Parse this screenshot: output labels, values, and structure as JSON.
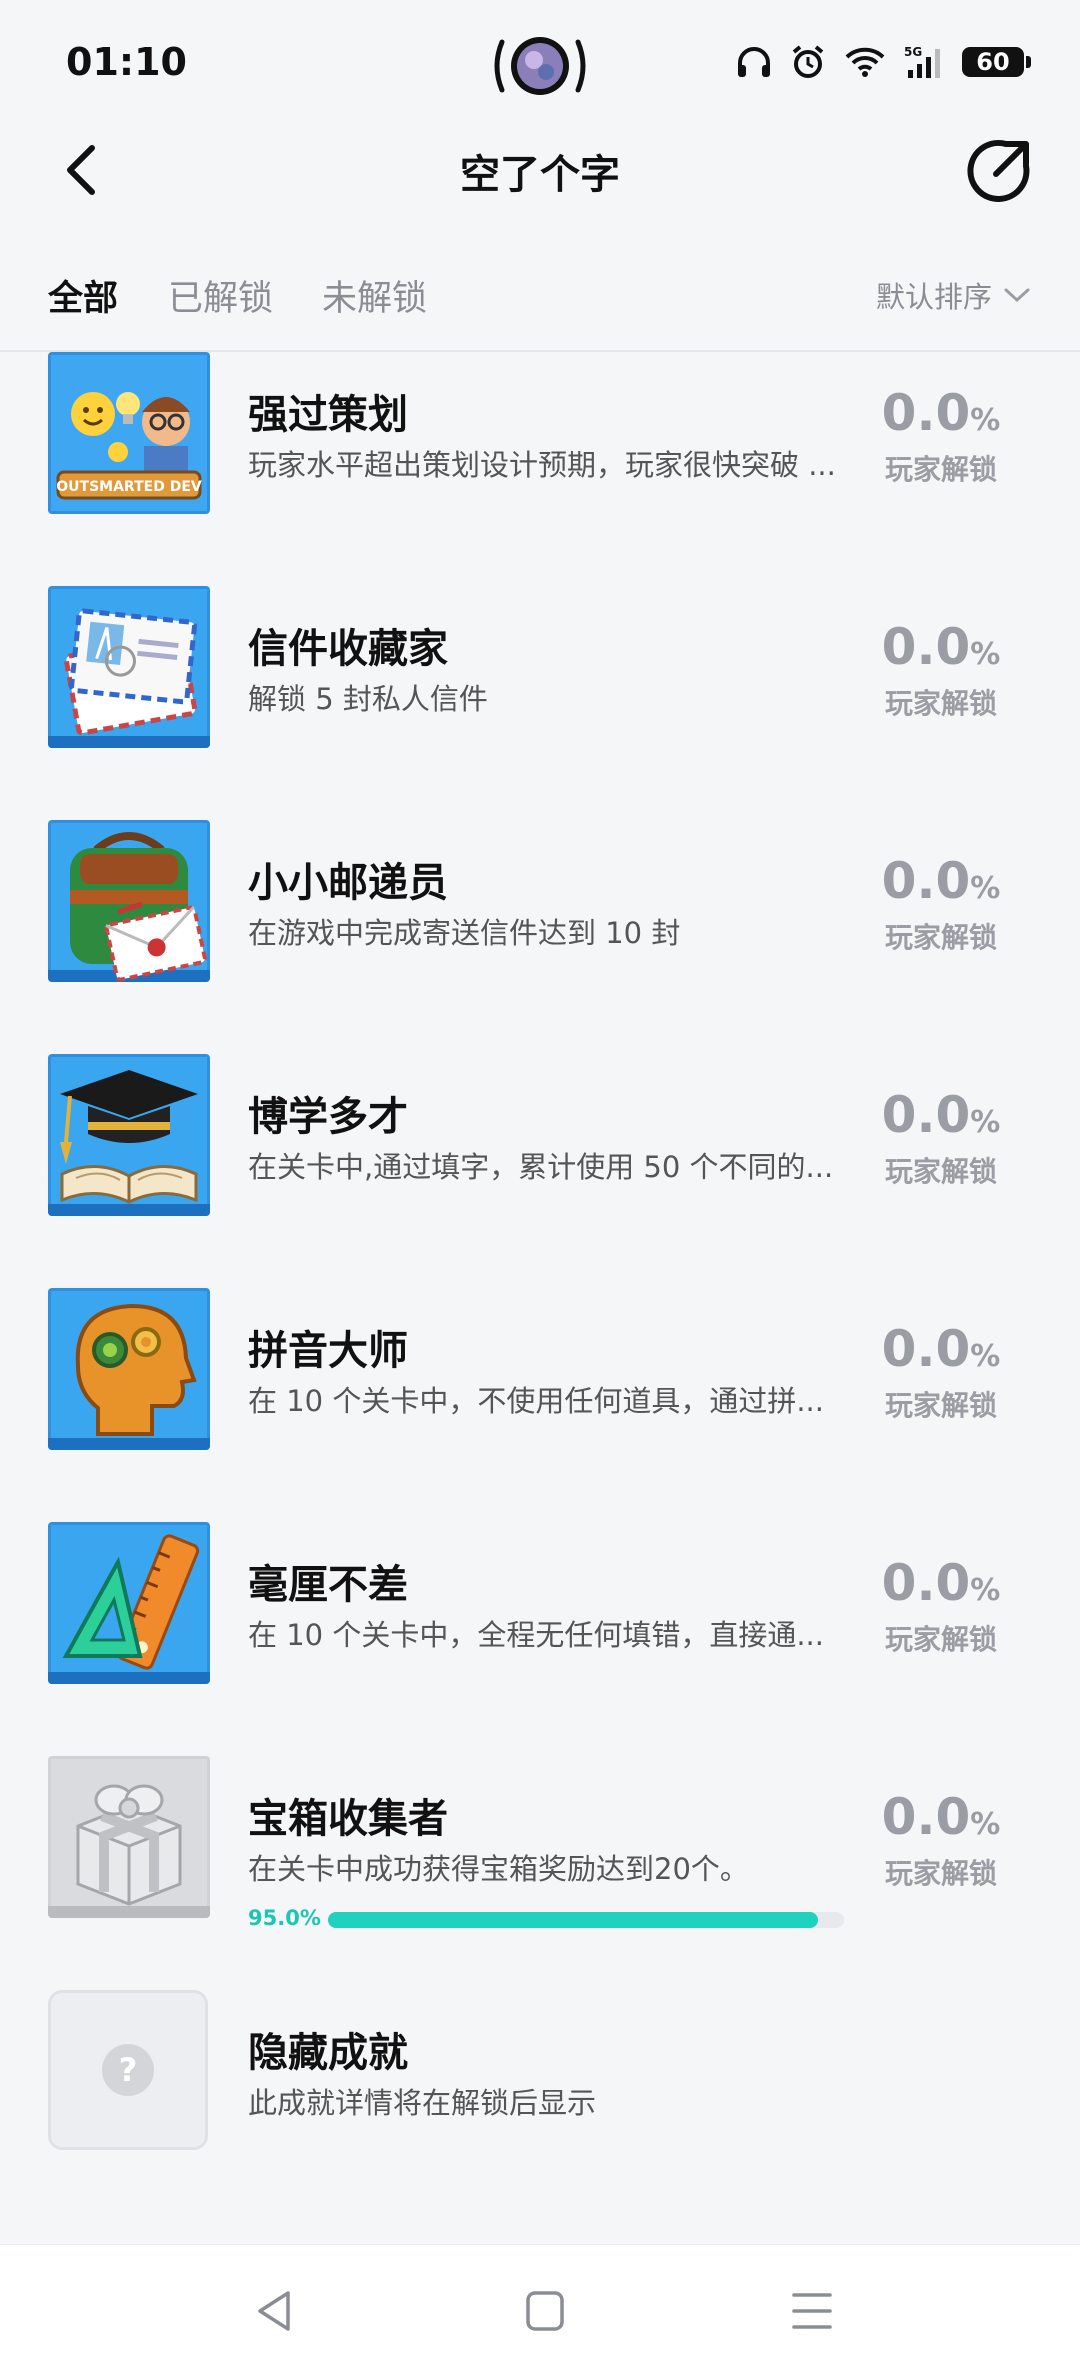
{
  "status_bar": {
    "time": "01:10",
    "battery": "60"
  },
  "header": {
    "title": "空了个字"
  },
  "tabs": [
    {
      "label": "全部",
      "active": true
    },
    {
      "label": "已解锁",
      "active": false
    },
    {
      "label": "未解锁",
      "active": false
    }
  ],
  "sort": {
    "label": "默认排序"
  },
  "achievements": [
    {
      "name": "强过策划",
      "desc": "玩家水平超出策划设计预期，玩家很快突破 ...",
      "percent": "0.0",
      "percent_sign": "%",
      "unlock_label": "玩家解锁",
      "icon": "outsmarted-dev-icon"
    },
    {
      "name": "信件收藏家",
      "desc": "解锁 5 封私人信件",
      "percent": "0.0",
      "percent_sign": "%",
      "unlock_label": "玩家解锁",
      "icon": "letters-icon"
    },
    {
      "name": "小小邮递员",
      "desc": "在游戏中完成寄送信件达到 10 封",
      "percent": "0.0",
      "percent_sign": "%",
      "unlock_label": "玩家解锁",
      "icon": "mailbag-icon"
    },
    {
      "name": "博学多才",
      "desc": "在关卡中,通过填字，累计使用 50 个不同的...",
      "percent": "0.0",
      "percent_sign": "%",
      "unlock_label": "玩家解锁",
      "icon": "graduation-cap-icon"
    },
    {
      "name": "拼音大师",
      "desc": "在 10 个关卡中，不使用任何道具，通过拼...",
      "percent": "0.0",
      "percent_sign": "%",
      "unlock_label": "玩家解锁",
      "icon": "brain-gears-icon"
    },
    {
      "name": "毫厘不差",
      "desc": "在 10 个关卡中，全程无任何填错，直接通...",
      "percent": "0.0",
      "percent_sign": "%",
      "unlock_label": "玩家解锁",
      "icon": "ruler-icon"
    },
    {
      "name": "宝箱收集者",
      "desc": "在关卡中成功获得宝箱奖励达到20个。",
      "percent": "0.0",
      "percent_sign": "%",
      "unlock_label": "玩家解锁",
      "icon": "treasure-box-icon",
      "progress_text": "95.0%",
      "progress": 0.95
    }
  ],
  "hidden_achievement": {
    "name": "隐藏成就",
    "desc": "此成就详情将在解锁后显示",
    "icon": "question-mark-icon"
  }
}
